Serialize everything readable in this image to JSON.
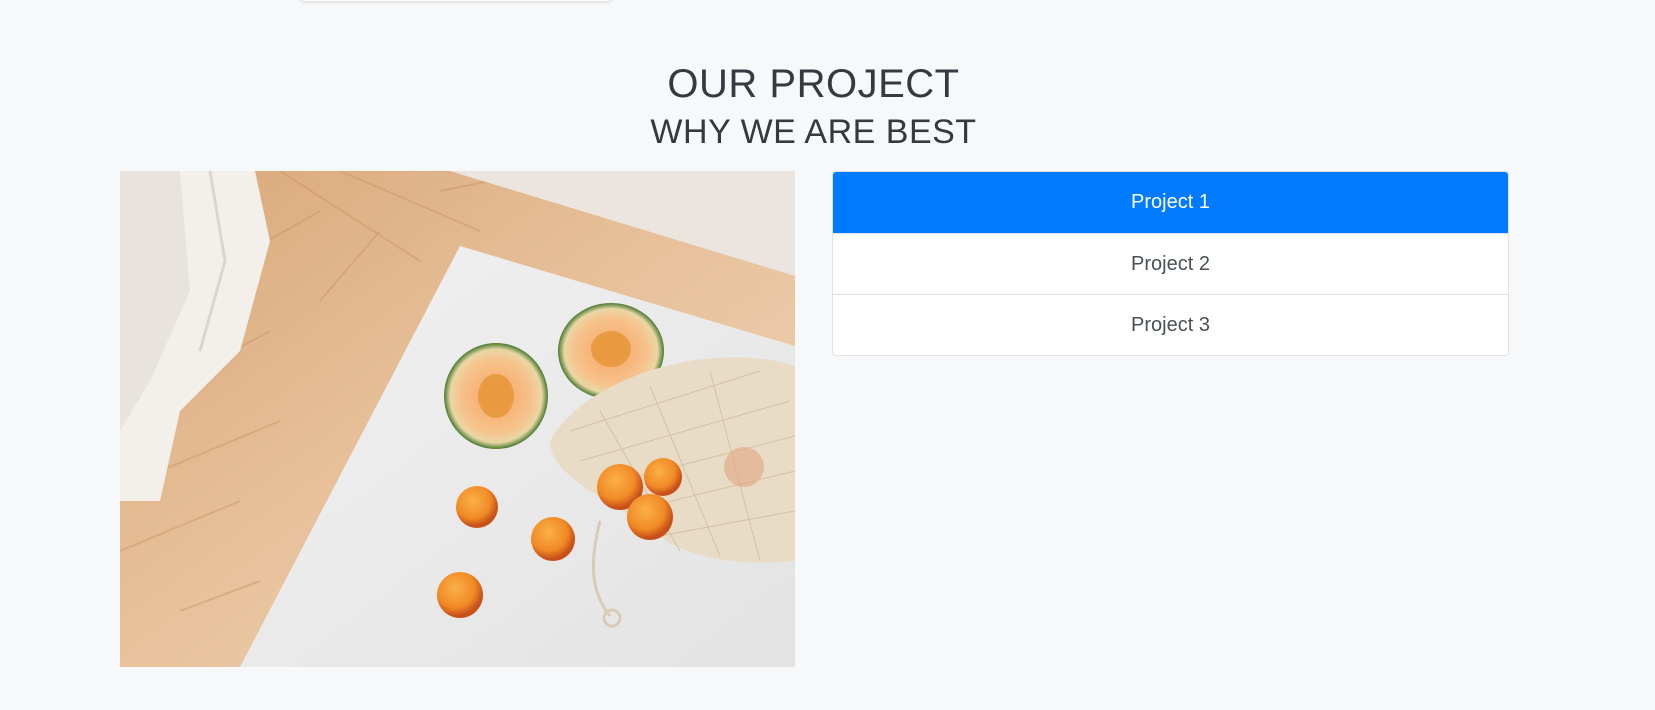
{
  "section": {
    "title": "OUR PROJECT",
    "subtitle": "WHY WE ARE BEST"
  },
  "photo": {
    "subject": "melons and apricots on a white table"
  },
  "project_list": {
    "active_index": 0,
    "accent_color": "#007bff",
    "items": [
      {
        "label": "Project 1",
        "active": true
      },
      {
        "label": "Project 2",
        "active": false
      },
      {
        "label": "Project 3",
        "active": false
      }
    ]
  }
}
